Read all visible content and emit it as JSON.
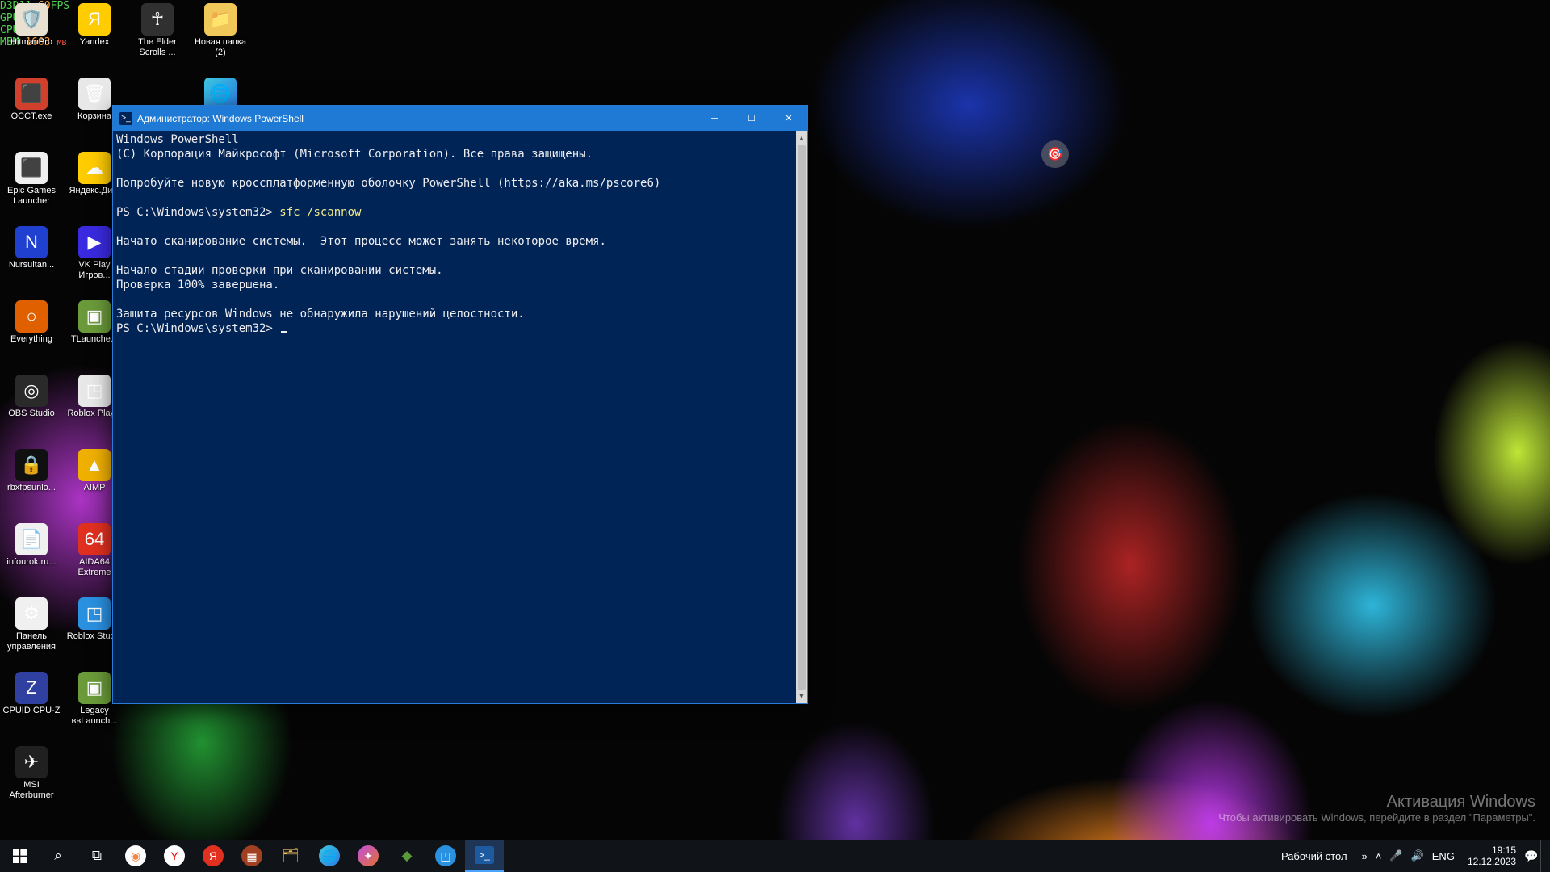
{
  "overlay": {
    "api": "D3D11",
    "fps_label": "FPS",
    "fps": "60",
    "mem_label": "MEM",
    "mem": "1603",
    "mem_unit": "MB"
  },
  "icons": {
    "col0": [
      {
        "name": "HitmanPro",
        "bg": "#e8e0d0",
        "glyph": "🛡️"
      },
      {
        "name": "OCCT.exe",
        "bg": "#d0402c",
        "glyph": "⬛"
      },
      {
        "name": "Epic Games Launcher",
        "bg": "#f0f0f0",
        "glyph": "⬛"
      },
      {
        "name": "Nursultan...",
        "bg": "#2040d0",
        "glyph": "N"
      },
      {
        "name": "Everything",
        "bg": "#e06000",
        "glyph": "○"
      },
      {
        "name": "OBS Studio",
        "bg": "#2a2a2a",
        "glyph": "◎"
      },
      {
        "name": "rbxfpsunlo...",
        "bg": "#101010",
        "glyph": "🔒"
      },
      {
        "name": "infourok.ru...",
        "bg": "#f0f0f0",
        "glyph": "📄"
      },
      {
        "name": "Панель управления",
        "bg": "#f0f0f0",
        "glyph": "⚙"
      },
      {
        "name": "CPUID CPU-Z",
        "bg": "#3040a0",
        "glyph": "Z"
      },
      {
        "name": "MSI Afterburner",
        "bg": "#202020",
        "glyph": "✈"
      }
    ],
    "col1": [
      {
        "name": "Yandex",
        "bg": "#ffcc00",
        "glyph": "Я"
      },
      {
        "name": "Корзина",
        "bg": "#e8e8e8",
        "glyph": "🗑"
      },
      {
        "name": "Яндекс.Ди...",
        "bg": "#ffcc00",
        "glyph": "☁"
      },
      {
        "name": "VK Play Игров...",
        "bg": "#3a2ae0",
        "glyph": "▶"
      },
      {
        "name": "TLaunche...",
        "bg": "#6a9a3a",
        "glyph": "▣"
      },
      {
        "name": "Roblox Play...",
        "bg": "#e8e8e8",
        "glyph": "◳"
      },
      {
        "name": "AIMP",
        "bg": "#f0b000",
        "glyph": "▲"
      },
      {
        "name": "AIDA64 Extreme",
        "bg": "#e03020",
        "glyph": "64"
      },
      {
        "name": "Roblox Studio",
        "bg": "#2a90e0",
        "glyph": "◳"
      },
      {
        "name": "Legacy ввLaunch...",
        "bg": "#6a9a3a",
        "glyph": "▣"
      }
    ],
    "col2": [
      {
        "name": "The Elder Scrolls ...",
        "bg": "#303030",
        "glyph": "☥"
      }
    ],
    "col3": [
      {
        "name": "Новая папка (2)",
        "bg": "#f0c85a",
        "glyph": "📁"
      },
      {
        "name": "",
        "bg": "transparent",
        "glyph": ""
      }
    ]
  },
  "ps": {
    "title": "Администратор: Windows PowerShell",
    "l1": "Windows PowerShell",
    "l2": "(C) Корпорация Майкрософт (Microsoft Corporation). Все права защищены.",
    "l3": "Попробуйте новую кроссплатформенную оболочку PowerShell (https://aka.ms/pscore6)",
    "prompt1": "PS C:\\Windows\\system32> ",
    "cmd1": "sfc /scannow",
    "l4": "Начато сканирование системы.  Этот процесс может занять некоторое время.",
    "l5": "Начало стадии проверки при сканировании системы.",
    "l6": "Проверка 100% завершена.",
    "l7": "Защита ресурсов Windows не обнаружила нарушений целостности.",
    "prompt2": "PS C:\\Windows\\system32> "
  },
  "watermark": {
    "l1": "Активация Windows",
    "l2": "Чтобы активировать Windows, перейдите в раздел \"Параметры\"."
  },
  "taskbar": {
    "desk_label": "Рабочий стол",
    "lang": "ENG",
    "time": "19:15",
    "date": "12.12.2023"
  }
}
